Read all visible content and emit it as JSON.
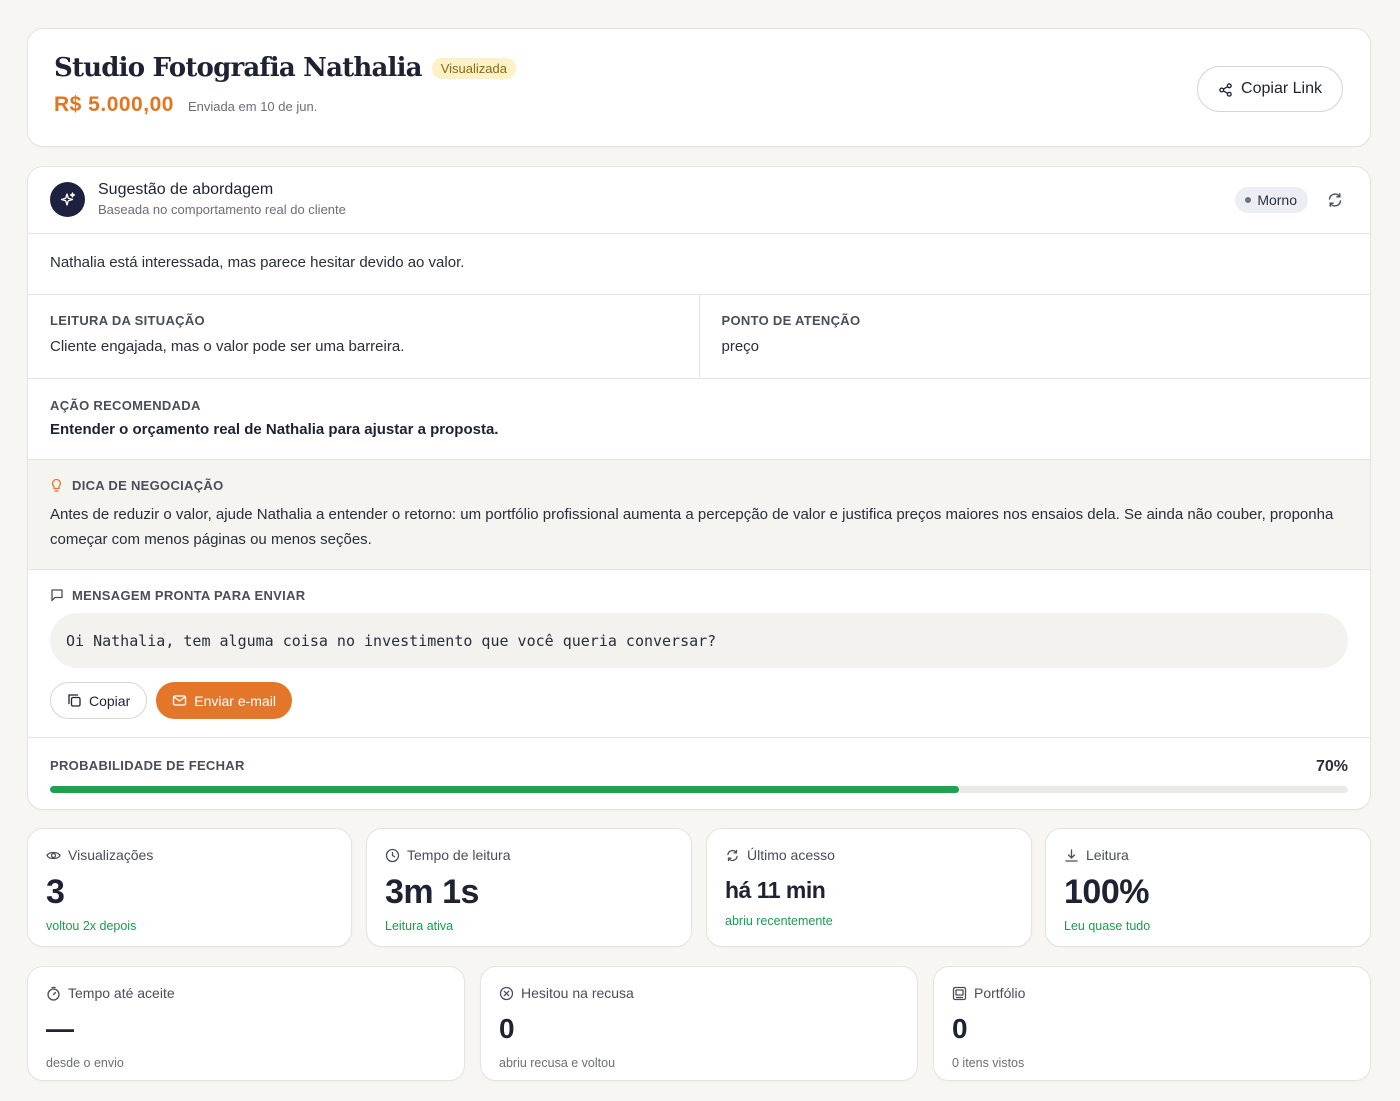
{
  "header": {
    "title": "Studio Fotografia Nathalia",
    "status": "Visualizada",
    "price": "R$ 5.000,00",
    "sent": "Enviada em 10 de jun.",
    "copy_link": "Copiar Link"
  },
  "suggestion": {
    "title": "Sugestão de abordagem",
    "subtitle": "Baseada no comportamento real do cliente",
    "temperature": "Morno",
    "summary": "Nathalia está interessada, mas parece hesitar devido ao valor.",
    "situation_label": "LEITURA DA SITUAÇÃO",
    "situation_text": "Cliente engajada, mas o valor pode ser uma barreira.",
    "attention_label": "PONTO DE ATENÇÃO",
    "attention_text": "preço",
    "action_label": "AÇÃO RECOMENDADA",
    "action_text": "Entender o orçamento real de Nathalia para ajustar a proposta.",
    "tip_label": "DICA DE NEGOCIAÇÃO",
    "tip_text": "Antes de reduzir o valor, ajude Nathalia a entender o retorno: um portfólio profissional aumenta a percepção de valor e justifica preços maiores nos ensaios dela. Se ainda não couber, proponha começar com menos páginas ou menos seções.",
    "message_label": "MENSAGEM PRONTA PARA ENVIAR",
    "message_text": "Oi Nathalia, tem alguma coisa no investimento que você queria conversar?",
    "copy_button": "Copiar",
    "email_button": "Enviar e-mail",
    "probability_label": "PROBABILIDADE DE FECHAR",
    "probability_text": "70%",
    "probability": 0.7
  },
  "metrics": [
    {
      "label": "Visualizações",
      "value": "3",
      "note": "voltou 2x depois",
      "icon": "eye-icon"
    },
    {
      "label": "Tempo de leitura",
      "value": "3m 1s",
      "note": "Leitura ativa",
      "icon": "clock-icon"
    },
    {
      "label": "Último acesso",
      "value": "há 11 min",
      "note": "abriu recentemente",
      "icon": "refresh-icon"
    },
    {
      "label": "Leitura",
      "value": "100%",
      "note": "Leu quase tudo",
      "icon": "download-icon"
    }
  ],
  "metrics2": [
    {
      "label": "Tempo até aceite",
      "value": "—",
      "note": "desde o envio",
      "icon": "timer-icon"
    },
    {
      "label": "Hesitou na recusa",
      "value": "0",
      "note": "abriu recusa e voltou",
      "icon": "x-circle-icon"
    },
    {
      "label": "Portfólio",
      "value": "0",
      "note": "0 itens vistos",
      "icon": "gallery-icon"
    }
  ],
  "colors": {
    "accent": "#e4762a",
    "price": "#e0761f",
    "success": "#22a04e",
    "note_green": "#1a9b52",
    "avatar_bg": "#1e2040",
    "badge_bg": "#fdf1c7"
  }
}
